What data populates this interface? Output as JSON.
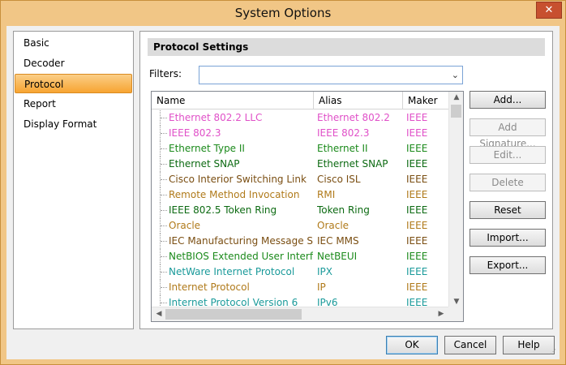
{
  "window": {
    "title": "System Options",
    "close_glyph": "✕",
    "close_icon": "close-icon"
  },
  "nav": {
    "items": [
      {
        "label": "Basic"
      },
      {
        "label": "Decoder"
      },
      {
        "label": "Protocol",
        "selected": true
      },
      {
        "label": "Report"
      },
      {
        "label": "Display Format"
      }
    ]
  },
  "panel": {
    "title": "Protocol Settings",
    "filters_label": "Filters:",
    "filters_value": ""
  },
  "grid": {
    "columns": [
      "Name",
      "Alias",
      "Maker"
    ],
    "rows": [
      {
        "name": "Ethernet 802.2 LLC",
        "alias": "Ethernet 802.2",
        "maker": "IEEE",
        "color": "#e050c8"
      },
      {
        "name": "IEEE 802.3",
        "alias": "IEEE 802.3",
        "maker": "IEEE",
        "color": "#e050c8"
      },
      {
        "name": "Ethernet Type II",
        "alias": "Ethernet II",
        "maker": "IEEE",
        "color": "#1b8a1b"
      },
      {
        "name": "Ethernet SNAP",
        "alias": "Ethernet SNAP",
        "maker": "IEEE",
        "color": "#0c6a12"
      },
      {
        "name": "Cisco Interior Switching Link",
        "alias": "Cisco ISL",
        "maker": "IEEE",
        "color": "#7a4e12"
      },
      {
        "name": "Remote Method Invocation",
        "alias": "RMI",
        "maker": "IEEE",
        "color": "#b07a1a"
      },
      {
        "name": "IEEE 802.5 Token Ring",
        "alias": "Token Ring",
        "maker": "IEEE",
        "color": "#0c6a12"
      },
      {
        "name": "Oracle",
        "alias": "Oracle",
        "maker": "IEEE",
        "color": "#b07a1a"
      },
      {
        "name": "IEC Manufacturing Message S...",
        "alias": "IEC MMS",
        "maker": "IEEE",
        "color": "#7a4e12"
      },
      {
        "name": "NetBIOS Extended User Interface",
        "alias": "NetBEUI",
        "maker": "IEEE",
        "color": "#1b8a1b"
      },
      {
        "name": "NetWare Internet Protocol",
        "alias": "IPX",
        "maker": "IEEE",
        "color": "#1a9a9a"
      },
      {
        "name": "Internet Protocol",
        "alias": "IP",
        "maker": "IEEE",
        "color": "#b07a1a"
      },
      {
        "name": "Internet Protocol Version 6",
        "alias": "IPv6",
        "maker": "IEEE",
        "color": "#1a9a9a"
      }
    ]
  },
  "side_buttons": [
    {
      "label": "Add...",
      "enabled": true
    },
    {
      "label": "Add Signature...",
      "enabled": false
    },
    {
      "label": "Edit...",
      "enabled": false
    },
    {
      "label": "Delete",
      "enabled": false
    },
    {
      "label": "Reset",
      "enabled": true
    },
    {
      "label": "Import...",
      "enabled": true
    },
    {
      "label": "Export...",
      "enabled": true
    }
  ],
  "footer": {
    "ok": "OK",
    "cancel": "Cancel",
    "help": "Help"
  }
}
